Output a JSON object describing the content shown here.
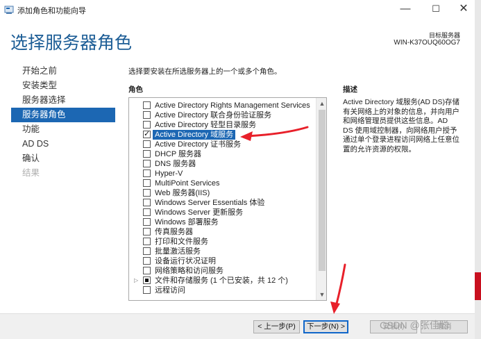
{
  "window": {
    "title": "添加角色和功能向导",
    "minimize_glyph": "—",
    "maximize_glyph": "☐",
    "close_glyph": "✕"
  },
  "header": {
    "title": "选择服务器角色",
    "target_label": "目标服务器",
    "target_name": "WIN-K37OUQ60OG7"
  },
  "nav": {
    "items": [
      {
        "label": "开始之前",
        "state": "normal"
      },
      {
        "label": "安装类型",
        "state": "normal"
      },
      {
        "label": "服务器选择",
        "state": "normal"
      },
      {
        "label": "服务器角色",
        "state": "active"
      },
      {
        "label": "功能",
        "state": "normal"
      },
      {
        "label": "AD DS",
        "state": "normal"
      },
      {
        "label": "确认",
        "state": "normal"
      },
      {
        "label": "结果",
        "state": "disabled"
      }
    ]
  },
  "main": {
    "intro": "选择要安装在所选服务器上的一个或多个角色。",
    "roles_heading": "角色",
    "description_heading": "描述",
    "description_text": "Active Directory 域服务(AD DS)存储有关网络上的对象的信息，并向用户和网络管理员提供这些信息。AD DS 使用域控制器，向网络用户授予通过单个登录进程访问网络上任意位置的允许资源的权限。",
    "roles": [
      {
        "label": "Active Directory Rights Management Services",
        "state": "unchecked",
        "expandable": false
      },
      {
        "label": "Active Directory 联合身份验证服务",
        "state": "unchecked",
        "expandable": false
      },
      {
        "label": "Active Directory 轻型目录服务",
        "state": "unchecked",
        "expandable": false
      },
      {
        "label": "Active Directory 域服务",
        "state": "checked",
        "expandable": false,
        "selected": true
      },
      {
        "label": "Active Directory 证书服务",
        "state": "unchecked",
        "expandable": false
      },
      {
        "label": "DHCP 服务器",
        "state": "unchecked",
        "expandable": false
      },
      {
        "label": "DNS 服务器",
        "state": "unchecked",
        "expandable": false
      },
      {
        "label": "Hyper-V",
        "state": "unchecked",
        "expandable": false
      },
      {
        "label": "MultiPoint Services",
        "state": "unchecked",
        "expandable": false
      },
      {
        "label": "Web 服务器(IIS)",
        "state": "unchecked",
        "expandable": false
      },
      {
        "label": "Windows Server Essentials 体验",
        "state": "unchecked",
        "expandable": false
      },
      {
        "label": "Windows Server 更新服务",
        "state": "unchecked",
        "expandable": false
      },
      {
        "label": "Windows 部署服务",
        "state": "unchecked",
        "expandable": false
      },
      {
        "label": "传真服务器",
        "state": "unchecked",
        "expandable": false
      },
      {
        "label": "打印和文件服务",
        "state": "unchecked",
        "expandable": false
      },
      {
        "label": "批量激活服务",
        "state": "unchecked",
        "expandable": false
      },
      {
        "label": "设备运行状况证明",
        "state": "unchecked",
        "expandable": false
      },
      {
        "label": "网络策略和访问服务",
        "state": "unchecked",
        "expandable": false
      },
      {
        "label": "文件和存储服务 (1 个已安装，共 12 个)",
        "state": "partial",
        "expandable": true
      },
      {
        "label": "远程访问",
        "state": "unchecked",
        "expandable": false
      }
    ]
  },
  "footer": {
    "prev_label": "< 上一步(P)",
    "next_label": "下一步(N) >",
    "install_label": "安装(I)",
    "cancel_label": "取消"
  },
  "overlay": {
    "watermark": "CSDN @张佳聪",
    "arrow_color": "#e8202a"
  },
  "colors": {
    "accent": "#1c67b3",
    "header_title": "#1b5c95"
  }
}
